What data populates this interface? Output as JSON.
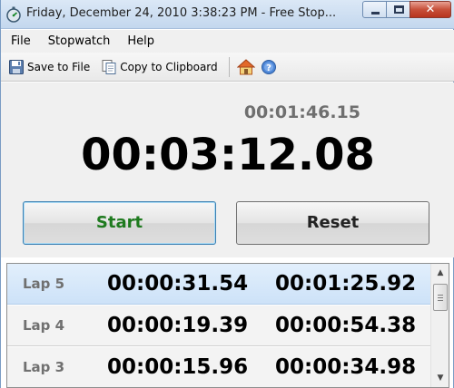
{
  "window": {
    "title": "Friday, December 24, 2010 3:38:23 PM - Free Stop...",
    "app_icon": "stopwatch-icon",
    "controls": {
      "minimize": "minimize-icon",
      "maximize": "maximize-icon",
      "close_glyph": "✕"
    }
  },
  "menu": {
    "items": [
      "File",
      "Stopwatch",
      "Help"
    ]
  },
  "toolbar": {
    "save_label": "Save to File",
    "copy_label": "Copy to Clipboard",
    "home_icon": "home-icon",
    "help_icon": "help-icon"
  },
  "timer": {
    "lap_time": "00:01:46.15",
    "total_time": "00:03:12.08"
  },
  "buttons": {
    "start": "Start",
    "reset": "Reset"
  },
  "laps": [
    {
      "name": "Lap 5",
      "split": "00:00:31.54",
      "total": "00:01:25.92",
      "selected": true
    },
    {
      "name": "Lap 4",
      "split": "00:00:19.39",
      "total": "00:00:54.38",
      "selected": false
    },
    {
      "name": "Lap 3",
      "split": "00:00:15.96",
      "total": "00:00:34.98",
      "selected": false
    }
  ],
  "colors": {
    "start_text": "#1e7a1e",
    "selected_row": "#cde2f8",
    "small_time": "#6f6f6f"
  }
}
